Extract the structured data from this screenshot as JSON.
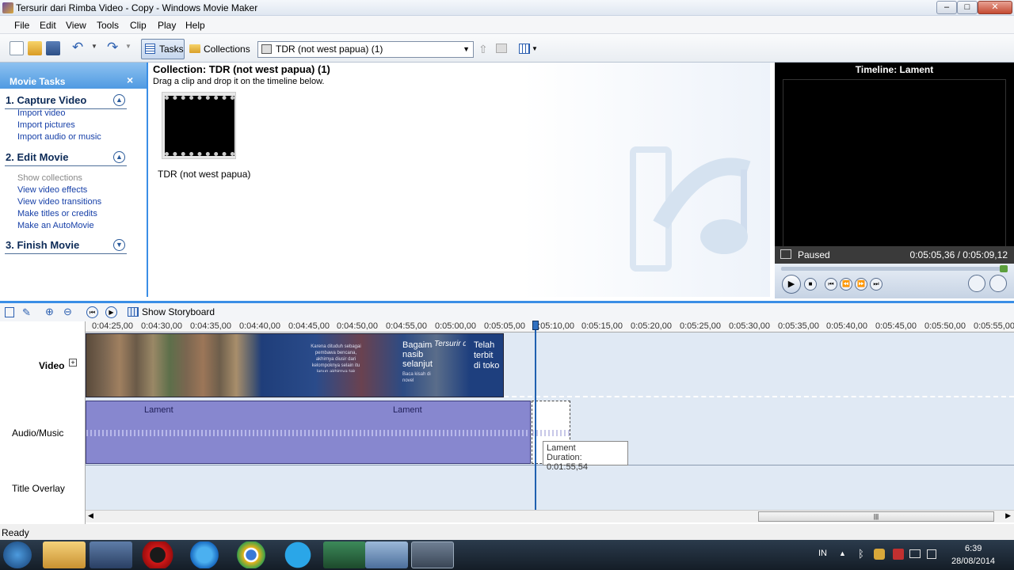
{
  "window": {
    "title": "Tersurir dari Rimba Video - Copy - Windows Movie Maker",
    "controls": {
      "minimize": "–",
      "maximize": "□",
      "close": "✕"
    }
  },
  "menu": [
    "File",
    "Edit",
    "View",
    "Tools",
    "Clip",
    "Play",
    "Help"
  ],
  "toolbar": {
    "tasks_label": "Tasks",
    "collections_label": "Collections",
    "collection_select": "TDR (not west papua) (1)"
  },
  "movie_tasks": {
    "header": "Movie Tasks",
    "close": "×",
    "sections": [
      {
        "title": "1. Capture Video",
        "links": [
          "Import video",
          "Import pictures",
          "Import audio or music"
        ]
      },
      {
        "title": "2. Edit Movie",
        "links": [
          "Show collections",
          "View video effects",
          "View video transitions",
          "Make titles or credits",
          "Make an AutoMovie"
        ]
      },
      {
        "title": "3. Finish Movie",
        "links": []
      }
    ]
  },
  "collection": {
    "title": "Collection: TDR (not west papua) (1)",
    "instruction": "Drag a clip and drop it on the timeline below.",
    "clip_name": "TDR (not west papua)"
  },
  "preview": {
    "title": "Timeline: Lament",
    "status": "Paused",
    "time": "0:05:05,36 / 0:05:09,12"
  },
  "timeline": {
    "storyboard_label": "Show Storyboard",
    "ticks": [
      "0:04:25,00",
      "0:04:30,00",
      "0:04:35,00",
      "0:04:40,00",
      "0:04:45,00",
      "0:04:50,00",
      "0:04:55,00",
      "0:05:00,00",
      "0:05:05,00",
      "0:05:10,00",
      "0:05:15,00",
      "0:05:20,00",
      "0:05:25,00",
      "0:05:30,00",
      "0:05:35,00",
      "0:05:40,00",
      "0:05:45,00",
      "0:05:50,00",
      "0:05:55,00"
    ],
    "tracks": {
      "video": "Video",
      "audio": "Audio/Music",
      "title": "Title Overlay"
    },
    "audio_clip_labels": [
      "Lament",
      "Lament"
    ],
    "clip_texts": {
      "text1": "Karena dituduh sebagai pembawa bencana, akhirnya diusir dari kelompoknya selain itu lapun akhirnya tak menikah dngn tunangannya",
      "text2": "Bagaimana nasib selanjutnya",
      "text3": "Baca kisah di novel",
      "text4": "Tersurir dari Rimba",
      "text5": "Telah terbit di toko terdekat"
    },
    "tooltip": {
      "name": "Lament",
      "duration": "Duration:  0:01:55,54"
    }
  },
  "status_bar": {
    "text": "Ready"
  },
  "taskbar": {
    "lang": "IN",
    "time": "6:39",
    "date": "28/08/2014"
  }
}
